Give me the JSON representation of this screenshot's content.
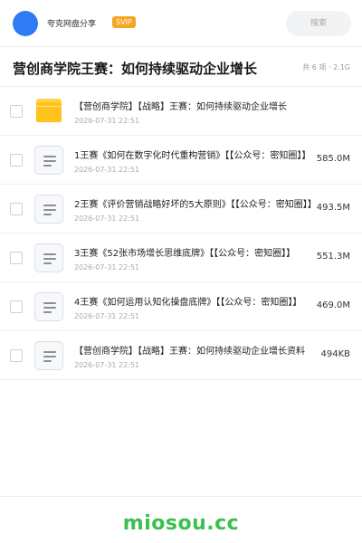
{
  "header": {
    "share_name": "夸克网盘分享",
    "badge": "SVIP",
    "search_placeholder": "搜索"
  },
  "title": {
    "text": "营创商学院王赛：如何持续驱动企业增长",
    "summary": "共 6 项 · 2.1G"
  },
  "files": [
    {
      "type": "folder",
      "icon": "folder-icon",
      "name": "【营创商学院】【战略】王赛：如何持续驱动企业增长",
      "date": "2026-07-31 22:51",
      "size": ""
    },
    {
      "type": "file",
      "icon": "document-icon",
      "name": "1王赛《如何在数字化时代重构营销》【【公众号：密知圈】】",
      "date": "2026-07-31 22:51",
      "size": "585.0M"
    },
    {
      "type": "file",
      "icon": "document-icon",
      "name": "2王赛《评价营销战略好坏的5大原则》【【公众号：密知圈】】",
      "date": "2026-07-31 22:51",
      "size": "493.5M"
    },
    {
      "type": "file",
      "icon": "document-icon",
      "name": "3王赛《52张市场增长思维底牌》【【公众号：密知圈】】",
      "date": "2026-07-31 22:51",
      "size": "551.3M"
    },
    {
      "type": "file",
      "icon": "document-icon",
      "name": "4王赛《如何运用认知化操盘底牌》【【公众号：密知圈】】",
      "date": "2026-07-31 22:51",
      "size": "469.0M"
    },
    {
      "type": "file",
      "icon": "document-icon",
      "name": "【营创商学院】【战略】王赛：如何持续驱动企业增长资料",
      "date": "2026-07-31 22:51",
      "size": "494KB"
    }
  ],
  "footer": {
    "watermark": "miosou.cc"
  },
  "colors": {
    "accent": "#2f7bf5",
    "badge": "#f5a623",
    "folder": "#ffc21a",
    "watermark": "#3bbf4f"
  }
}
